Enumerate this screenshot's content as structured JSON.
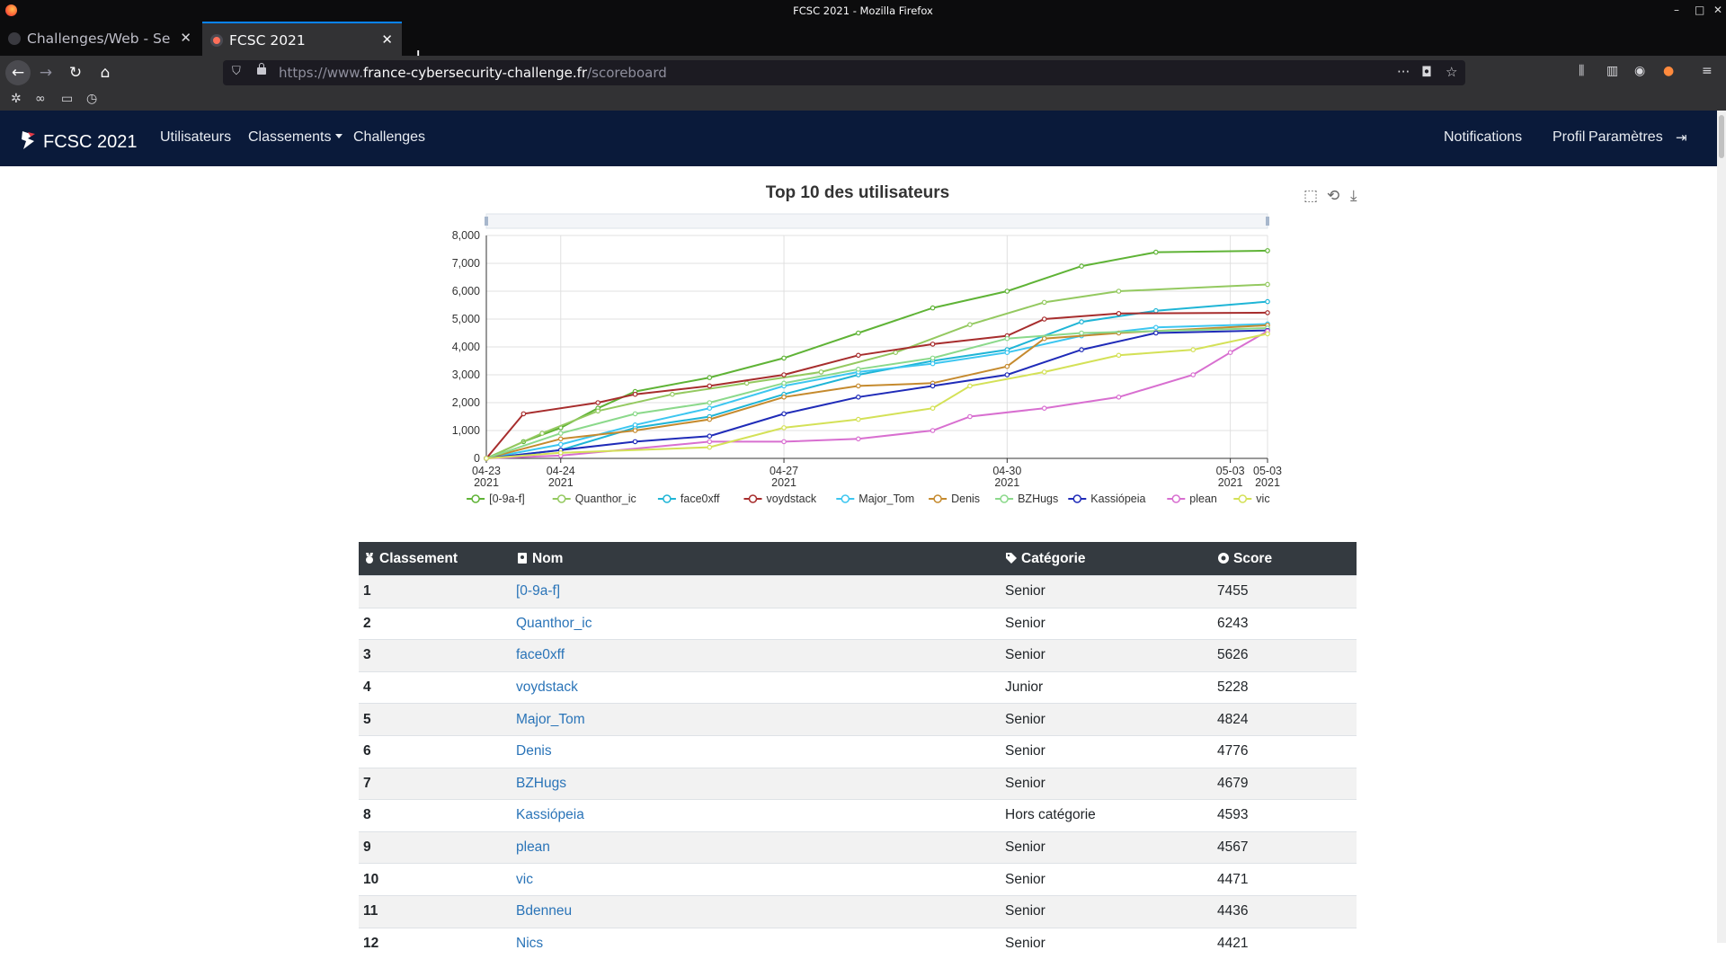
{
  "window": {
    "title": "FCSC 2021 - Mozilla Firefox"
  },
  "tabs": [
    {
      "label": "Challenges/Web - Serveu",
      "active": false
    },
    {
      "label": "FCSC 2021",
      "active": true
    }
  ],
  "urlbar": {
    "prefix": "https://www.",
    "domain": "france-cybersecurity-challenge.fr",
    "path": "/scoreboard"
  },
  "site": {
    "brand": "FCSC 2021",
    "nav_left": [
      "Utilisateurs",
      "Classements",
      "Challenges"
    ],
    "nav_right": [
      "Notifications",
      "Profil",
      "Paramètres"
    ],
    "colors": {
      "navbar": "#0a1a3a",
      "table_header": "#343a40",
      "link": "#2a74b8"
    }
  },
  "chart_data": {
    "type": "line",
    "title": "Top 10 des utilisateurs",
    "x_ticks": [
      {
        "date": "2021-04-23",
        "label": "04-23",
        "year": "2021"
      },
      {
        "date": "2021-04-24",
        "label": "04-24",
        "year": "2021"
      },
      {
        "date": "2021-04-27",
        "label": "04-27",
        "year": "2021"
      },
      {
        "date": "2021-04-30",
        "label": "04-30",
        "year": "2021"
      },
      {
        "date": "2021-05-03",
        "label": "05-03",
        "year": "2021"
      },
      {
        "date": "2021-05-03T12:00",
        "label": "05-03",
        "year": "2021"
      }
    ],
    "xlim": [
      "2021-04-23",
      "2021-05-03T12:00"
    ],
    "ylim": [
      0,
      8000
    ],
    "y_ticks": [
      "0",
      "1,000",
      "2,000",
      "3,000",
      "4,000",
      "5,000",
      "6,000",
      "7,000",
      "8,000"
    ],
    "grid": true,
    "legend_position": "bottom",
    "series": [
      {
        "name": "[0-9a-f]",
        "color": "#5fb336",
        "points": [
          [
            "2021-04-23T00:00",
            0
          ],
          [
            "2021-04-23T12:00",
            600
          ],
          [
            "2021-04-24T00:00",
            1100
          ],
          [
            "2021-04-24T12:00",
            1800
          ],
          [
            "2021-04-25T00:00",
            2400
          ],
          [
            "2021-04-26T00:00",
            2900
          ],
          [
            "2021-04-27T00:00",
            3600
          ],
          [
            "2021-04-28T00:00",
            4500
          ],
          [
            "2021-04-29T00:00",
            5400
          ],
          [
            "2021-04-30T00:00",
            6000
          ],
          [
            "2021-05-01T00:00",
            6900
          ],
          [
            "2021-05-02T00:00",
            7400
          ],
          [
            "2021-05-03T12:00",
            7455
          ]
        ]
      },
      {
        "name": "Quanthor_ic",
        "color": "#94c960",
        "points": [
          [
            "2021-04-23T00:00",
            0
          ],
          [
            "2021-04-23T18:00",
            900
          ],
          [
            "2021-04-24T12:00",
            1700
          ],
          [
            "2021-04-25T12:00",
            2300
          ],
          [
            "2021-04-26T12:00",
            2700
          ],
          [
            "2021-04-27T12:00",
            3100
          ],
          [
            "2021-04-28T12:00",
            3800
          ],
          [
            "2021-04-29T12:00",
            4800
          ],
          [
            "2021-04-30T12:00",
            5600
          ],
          [
            "2021-05-01T12:00",
            6000
          ],
          [
            "2021-05-03T12:00",
            6243
          ]
        ]
      },
      {
        "name": "face0xff",
        "color": "#1fb5d6",
        "points": [
          [
            "2021-04-23T00:00",
            0
          ],
          [
            "2021-04-24T00:00",
            300
          ],
          [
            "2021-04-25T00:00",
            1100
          ],
          [
            "2021-04-26T00:00",
            1500
          ],
          [
            "2021-04-27T00:00",
            2300
          ],
          [
            "2021-04-28T00:00",
            3000
          ],
          [
            "2021-04-29T00:00",
            3500
          ],
          [
            "2021-04-30T00:00",
            3900
          ],
          [
            "2021-05-01T00:00",
            4900
          ],
          [
            "2021-05-02T00:00",
            5300
          ],
          [
            "2021-05-03T12:00",
            5626
          ]
        ]
      },
      {
        "name": "voydstack",
        "color": "#a72d2d",
        "points": [
          [
            "2021-04-23T00:00",
            0
          ],
          [
            "2021-04-23T12:00",
            1600
          ],
          [
            "2021-04-24T12:00",
            2000
          ],
          [
            "2021-04-25T00:00",
            2300
          ],
          [
            "2021-04-26T00:00",
            2600
          ],
          [
            "2021-04-27T00:00",
            3000
          ],
          [
            "2021-04-28T00:00",
            3700
          ],
          [
            "2021-04-29T00:00",
            4100
          ],
          [
            "2021-04-30T00:00",
            4400
          ],
          [
            "2021-04-30T12:00",
            5000
          ],
          [
            "2021-05-01T12:00",
            5200
          ],
          [
            "2021-05-03T12:00",
            5228
          ]
        ]
      },
      {
        "name": "Major_Tom",
        "color": "#3cc6f0",
        "points": [
          [
            "2021-04-23T00:00",
            0
          ],
          [
            "2021-04-24T00:00",
            500
          ],
          [
            "2021-04-25T00:00",
            1200
          ],
          [
            "2021-04-26T00:00",
            1800
          ],
          [
            "2021-04-27T00:00",
            2600
          ],
          [
            "2021-04-28T00:00",
            3100
          ],
          [
            "2021-04-29T00:00",
            3400
          ],
          [
            "2021-04-30T00:00",
            3800
          ],
          [
            "2021-05-01T00:00",
            4400
          ],
          [
            "2021-05-02T00:00",
            4700
          ],
          [
            "2021-05-03T12:00",
            4824
          ]
        ]
      },
      {
        "name": "Denis",
        "color": "#c58a2e",
        "points": [
          [
            "2021-04-23T00:00",
            0
          ],
          [
            "2021-04-24T00:00",
            700
          ],
          [
            "2021-04-25T00:00",
            1000
          ],
          [
            "2021-04-26T00:00",
            1400
          ],
          [
            "2021-04-27T00:00",
            2200
          ],
          [
            "2021-04-28T00:00",
            2600
          ],
          [
            "2021-04-29T00:00",
            2700
          ],
          [
            "2021-04-30T00:00",
            3300
          ],
          [
            "2021-04-30T12:00",
            4300
          ],
          [
            "2021-05-01T12:00",
            4500
          ],
          [
            "2021-05-03T12:00",
            4776
          ]
        ]
      },
      {
        "name": "BZHugs",
        "color": "#8bd98b",
        "points": [
          [
            "2021-04-23T00:00",
            0
          ],
          [
            "2021-04-24T00:00",
            900
          ],
          [
            "2021-04-25T00:00",
            1600
          ],
          [
            "2021-04-26T00:00",
            2000
          ],
          [
            "2021-04-27T00:00",
            2700
          ],
          [
            "2021-04-28T00:00",
            3200
          ],
          [
            "2021-04-29T00:00",
            3600
          ],
          [
            "2021-04-30T00:00",
            4300
          ],
          [
            "2021-05-01T00:00",
            4500
          ],
          [
            "2021-05-03T12:00",
            4679
          ]
        ]
      },
      {
        "name": "Kassiópeia",
        "color": "#1f2bb8",
        "points": [
          [
            "2021-04-23T00:00",
            0
          ],
          [
            "2021-04-24T00:00",
            300
          ],
          [
            "2021-04-25T00:00",
            600
          ],
          [
            "2021-04-26T00:00",
            800
          ],
          [
            "2021-04-27T00:00",
            1600
          ],
          [
            "2021-04-28T00:00",
            2200
          ],
          [
            "2021-04-29T00:00",
            2600
          ],
          [
            "2021-04-30T00:00",
            3000
          ],
          [
            "2021-05-01T00:00",
            3900
          ],
          [
            "2021-05-02T00:00",
            4500
          ],
          [
            "2021-05-03T12:00",
            4593
          ]
        ]
      },
      {
        "name": "plean",
        "color": "#d86fd0",
        "points": [
          [
            "2021-04-23T00:00",
            0
          ],
          [
            "2021-04-24T00:00",
            100
          ],
          [
            "2021-04-26T00:00",
            600
          ],
          [
            "2021-04-27T00:00",
            600
          ],
          [
            "2021-04-28T00:00",
            700
          ],
          [
            "2021-04-29T00:00",
            1000
          ],
          [
            "2021-04-29T12:00",
            1500
          ],
          [
            "2021-04-30T12:00",
            1800
          ],
          [
            "2021-05-01T12:00",
            2200
          ],
          [
            "2021-05-02T12:00",
            3000
          ],
          [
            "2021-05-03T00:00",
            3800
          ],
          [
            "2021-05-03T12:00",
            4567
          ]
        ]
      },
      {
        "name": "vic",
        "color": "#d4e157",
        "points": [
          [
            "2021-04-23T00:00",
            0
          ],
          [
            "2021-04-24T00:00",
            200
          ],
          [
            "2021-04-26T00:00",
            400
          ],
          [
            "2021-04-27T00:00",
            1100
          ],
          [
            "2021-04-28T00:00",
            1400
          ],
          [
            "2021-04-29T00:00",
            1800
          ],
          [
            "2021-04-29T12:00",
            2600
          ],
          [
            "2021-04-30T12:00",
            3100
          ],
          [
            "2021-05-01T12:00",
            3700
          ],
          [
            "2021-05-02T12:00",
            3900
          ],
          [
            "2021-05-03T12:00",
            4471
          ]
        ]
      }
    ]
  },
  "table": {
    "headers": [
      "Classement",
      "Nom",
      "Catégorie",
      "Score"
    ],
    "rows": [
      {
        "rank": "1",
        "name": "[0-9a-f]",
        "category": "Senior",
        "score": "7455"
      },
      {
        "rank": "2",
        "name": "Quanthor_ic",
        "category": "Senior",
        "score": "6243"
      },
      {
        "rank": "3",
        "name": "face0xff",
        "category": "Senior",
        "score": "5626"
      },
      {
        "rank": "4",
        "name": "voydstack",
        "category": "Junior",
        "score": "5228"
      },
      {
        "rank": "5",
        "name": "Major_Tom",
        "category": "Senior",
        "score": "4824"
      },
      {
        "rank": "6",
        "name": "Denis",
        "category": "Senior",
        "score": "4776"
      },
      {
        "rank": "7",
        "name": "BZHugs",
        "category": "Senior",
        "score": "4679"
      },
      {
        "rank": "8",
        "name": "Kassiópeia",
        "category": "Hors catégorie",
        "score": "4593"
      },
      {
        "rank": "9",
        "name": "plean",
        "category": "Senior",
        "score": "4567"
      },
      {
        "rank": "10",
        "name": "vic",
        "category": "Senior",
        "score": "4471"
      },
      {
        "rank": "11",
        "name": "Bdenneu",
        "category": "Senior",
        "score": "4436"
      },
      {
        "rank": "12",
        "name": "Nics",
        "category": "Senior",
        "score": "4421"
      }
    ]
  }
}
